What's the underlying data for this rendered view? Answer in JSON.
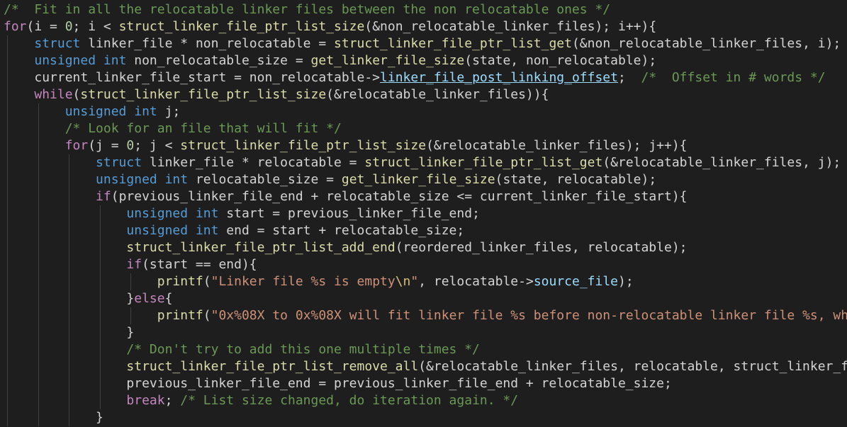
{
  "lines": [
    {
      "indent": 0,
      "tokens": [
        [
          "cmt",
          "/*  Fit in all the relocatable linker files between the non relocatable ones */"
        ]
      ]
    },
    {
      "indent": 0,
      "tokens": [
        [
          "ctl",
          "for"
        ],
        [
          "op",
          "(i = "
        ],
        [
          "num",
          "0"
        ],
        [
          "op",
          "; i < "
        ],
        [
          "fn",
          "struct_linker_file_ptr_list_size"
        ],
        [
          "op",
          "(&non_relocatable_linker_files); i++){"
        ]
      ]
    },
    {
      "indent": 1,
      "tokens": [
        [
          "kw",
          "struct"
        ],
        [
          "op",
          " linker_file * non_relocatable = "
        ],
        [
          "fn",
          "struct_linker_file_ptr_list_get"
        ],
        [
          "op",
          "(&non_relocatable_linker_files, i);"
        ]
      ]
    },
    {
      "indent": 1,
      "tokens": [
        [
          "kw",
          "unsigned"
        ],
        [
          "op",
          " "
        ],
        [
          "kw",
          "int"
        ],
        [
          "op",
          " non_relocatable_size = "
        ],
        [
          "fn",
          "get_linker_file_size"
        ],
        [
          "op",
          "(state, non_relocatable);"
        ]
      ]
    },
    {
      "indent": 1,
      "tokens": [
        [
          "op",
          "current_linker_file_start = non_relocatable->"
        ],
        [
          "memu",
          "linker_file_post_linking_offset"
        ],
        [
          "op",
          ";  "
        ],
        [
          "cmt",
          "/*  Offset in # words */"
        ]
      ]
    },
    {
      "indent": 1,
      "tokens": [
        [
          "ctl",
          "while"
        ],
        [
          "op",
          "("
        ],
        [
          "fn",
          "struct_linker_file_ptr_list_size"
        ],
        [
          "op",
          "(&relocatable_linker_files)){"
        ]
      ]
    },
    {
      "indent": 2,
      "tokens": [
        [
          "kw",
          "unsigned"
        ],
        [
          "op",
          " "
        ],
        [
          "kw",
          "int"
        ],
        [
          "op",
          " j;"
        ]
      ]
    },
    {
      "indent": 2,
      "tokens": [
        [
          "cmt",
          "/* Look for an file that will fit */"
        ]
      ]
    },
    {
      "indent": 2,
      "tokens": [
        [
          "ctl",
          "for"
        ],
        [
          "op",
          "(j = "
        ],
        [
          "num",
          "0"
        ],
        [
          "op",
          "; j < "
        ],
        [
          "fn",
          "struct_linker_file_ptr_list_size"
        ],
        [
          "op",
          "(&relocatable_linker_files); j++){"
        ]
      ]
    },
    {
      "indent": 3,
      "tokens": [
        [
          "kw",
          "struct"
        ],
        [
          "op",
          " linker_file * relocatable = "
        ],
        [
          "fn",
          "struct_linker_file_ptr_list_get"
        ],
        [
          "op",
          "(&relocatable_linker_files, j);"
        ]
      ]
    },
    {
      "indent": 3,
      "tokens": [
        [
          "kw",
          "unsigned"
        ],
        [
          "op",
          " "
        ],
        [
          "kw",
          "int"
        ],
        [
          "op",
          " relocatable_size = "
        ],
        [
          "fn",
          "get_linker_file_size"
        ],
        [
          "op",
          "(state, relocatable);"
        ]
      ]
    },
    {
      "indent": 3,
      "tokens": [
        [
          "ctl",
          "if"
        ],
        [
          "op",
          "(previous_linker_file_end + relocatable_size <= current_linker_file_start){"
        ]
      ]
    },
    {
      "indent": 4,
      "tokens": [
        [
          "kw",
          "unsigned"
        ],
        [
          "op",
          " "
        ],
        [
          "kw",
          "int"
        ],
        [
          "op",
          " start = previous_linker_file_end;"
        ]
      ]
    },
    {
      "indent": 4,
      "tokens": [
        [
          "kw",
          "unsigned"
        ],
        [
          "op",
          " "
        ],
        [
          "kw",
          "int"
        ],
        [
          "op",
          " end = start + relocatable_size;"
        ]
      ]
    },
    {
      "indent": 4,
      "tokens": [
        [
          "fn",
          "struct_linker_file_ptr_list_add_end"
        ],
        [
          "op",
          "(reordered_linker_files, relocatable);"
        ]
      ]
    },
    {
      "indent": 4,
      "tokens": [
        [
          "ctl",
          "if"
        ],
        [
          "op",
          "(start == end){"
        ]
      ]
    },
    {
      "indent": 5,
      "tokens": [
        [
          "fn",
          "printf"
        ],
        [
          "op",
          "("
        ],
        [
          "str",
          "\"Linker file %s is empty"
        ],
        [
          "esc",
          "\\n"
        ],
        [
          "str",
          "\""
        ],
        [
          "op",
          ", relocatable->"
        ],
        [
          "mem",
          "source_file"
        ],
        [
          "op",
          ");"
        ]
      ]
    },
    {
      "indent": 4,
      "tokens": [
        [
          "op",
          "}"
        ],
        [
          "ctl",
          "else"
        ],
        [
          "op",
          "{"
        ]
      ]
    },
    {
      "indent": 5,
      "tokens": [
        [
          "fn",
          "printf"
        ],
        [
          "op",
          "("
        ],
        [
          "str",
          "\"0x%08X to 0x%08X will fit linker file %s before non-relocatable linker file %s, whi"
        ]
      ]
    },
    {
      "indent": 4,
      "tokens": [
        [
          "op",
          "}"
        ]
      ]
    },
    {
      "indent": 4,
      "tokens": [
        [
          "cmt",
          "/* Don't try to add this one multiple times */"
        ]
      ]
    },
    {
      "indent": 4,
      "tokens": [
        [
          "fn",
          "struct_linker_file_ptr_list_remove_all"
        ],
        [
          "op",
          "(&relocatable_linker_files, relocatable, struct_linker_fi"
        ]
      ]
    },
    {
      "indent": 4,
      "tokens": [
        [
          "op",
          "previous_linker_file_end = previous_linker_file_end + relocatable_size;"
        ]
      ]
    },
    {
      "indent": 4,
      "tokens": [
        [
          "ctl",
          "break"
        ],
        [
          "op",
          "; "
        ],
        [
          "cmt",
          "/* List size changed, do iteration again. */"
        ]
      ]
    },
    {
      "indent": 3,
      "tokens": [
        [
          "op",
          "}"
        ]
      ]
    }
  ]
}
